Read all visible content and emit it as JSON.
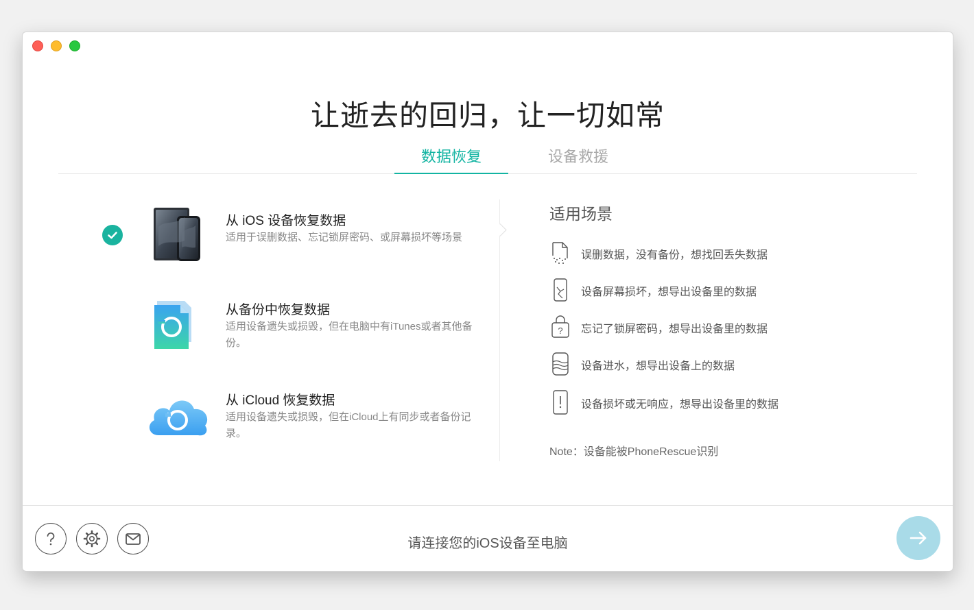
{
  "headline": "让逝去的回归，让一切如常",
  "tabs": [
    {
      "label": "数据恢复",
      "active": true
    },
    {
      "label": "设备救援",
      "active": false
    }
  ],
  "options": [
    {
      "title": "从 iOS 设备恢复数据",
      "desc": "适用于误删数据、忘记锁屏密码、或屏幕损坏等场景",
      "selected": true,
      "icon": "ios-devices-icon"
    },
    {
      "title": "从备份中恢复数据",
      "desc": "适用设备遗失或损毁，但在电脑中有iTunes或者其他备份。",
      "selected": false,
      "icon": "backup-file-icon"
    },
    {
      "title": "从 iCloud 恢复数据",
      "desc": "适用设备遗失或损毁，但在iCloud上有同步或者备份记录。",
      "selected": false,
      "icon": "icloud-restore-icon"
    }
  ],
  "scenarios": {
    "title": "适用场景",
    "items": [
      {
        "text": "误删数据，没有备份，想找回丢失数据",
        "icon": "deleted-file-icon"
      },
      {
        "text": "设备屏幕损坏，想导出设备里的数据",
        "icon": "broken-phone-icon"
      },
      {
        "text": "忘记了锁屏密码，想导出设备里的数据",
        "icon": "locked-question-icon"
      },
      {
        "text": "设备进水，想导出设备上的数据",
        "icon": "water-damage-icon"
      },
      {
        "text": "设备损坏或无响应，想导出设备里的数据",
        "icon": "phone-alert-icon"
      }
    ],
    "note": "Note：设备能被PhoneRescue识别"
  },
  "footer": {
    "status": "请连接您的iOS设备至电脑",
    "buttons": [
      "help-icon",
      "settings-icon",
      "mail-icon"
    ],
    "next_icon": "arrow-right-icon"
  },
  "colors": {
    "accent": "#13b4a2",
    "check": "#1ab39f",
    "next_button": "#a9dbe8"
  }
}
